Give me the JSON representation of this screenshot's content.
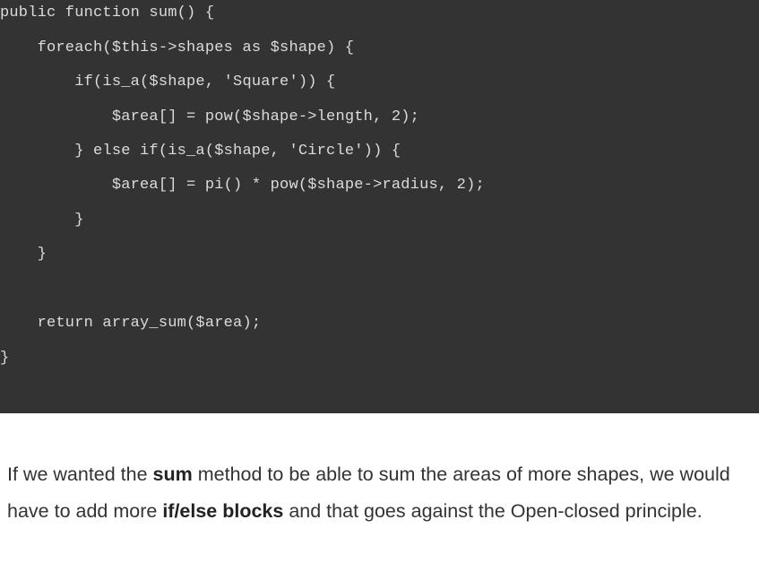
{
  "code": {
    "lines": [
      "public function sum() {",
      "    foreach($this->shapes as $shape) {",
      "        if(is_a($shape, 'Square')) {",
      "            $area[] = pow($shape->length, 2);",
      "        } else if(is_a($shape, 'Circle')) {",
      "            $area[] = pi() * pow($shape->radius, 2);",
      "        }",
      "    }",
      "",
      "    return array_sum($area);",
      "}"
    ]
  },
  "paragraph": {
    "part1": "If we wanted the ",
    "bold1": "sum",
    "part2": " method to be able to sum the areas of more shapes, we would have to add more ",
    "bold2": "if/else blocks",
    "part3": " and that goes against the Open-closed principle."
  }
}
